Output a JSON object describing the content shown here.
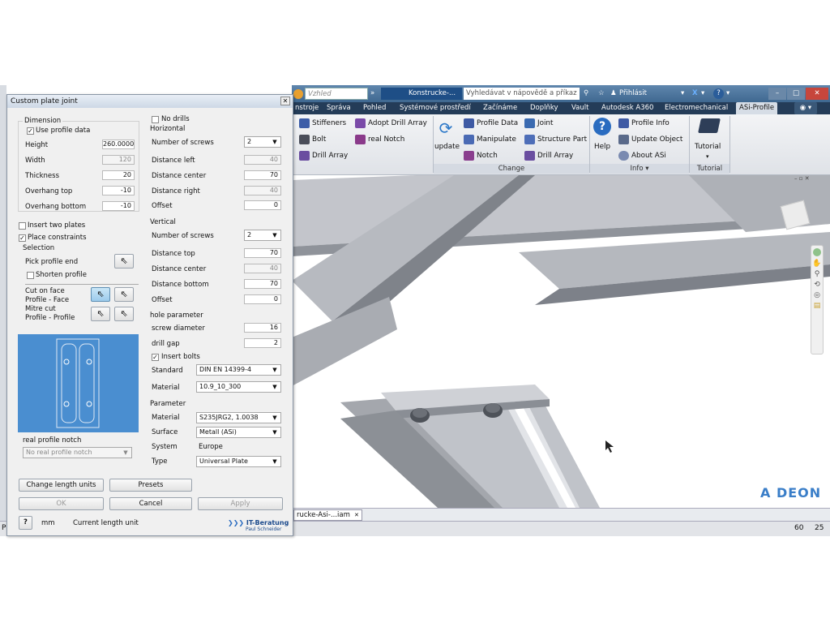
{
  "window": {
    "workspace": "Vzhled",
    "doc_title": "Konstrucke-...",
    "search_placeholder": "Vyhledávat v nápovědě a příkaz",
    "signin": "Přihlásit"
  },
  "ribbon_tabs": [
    "nstroje",
    "Správa",
    "Pohled",
    "Systémové prostředí",
    "Začínáme",
    "Doplňky",
    "Vault",
    "Autodesk A360",
    "Electromechanical",
    "ASi-Profile"
  ],
  "ribbon": {
    "col1": [
      "Stiffeners",
      "Bolt",
      "Drill Array"
    ],
    "col2": [
      "Adopt Drill Array",
      "real Notch"
    ],
    "update": "update",
    "col3": [
      "Profile Data",
      "Manipulate",
      "Notch"
    ],
    "col4": [
      "Joint",
      "Structure Part",
      "Drill Array"
    ],
    "help": "Help",
    "col5": [
      "Profile Info",
      "Update Object",
      "About ASi"
    ],
    "tutorial": "Tutorial",
    "groups": {
      "change": "Change",
      "info": "Info ▾",
      "tutorial": "Tutorial"
    }
  },
  "doc_tab": "rucke-Asi-...iam",
  "status": {
    "left": "P",
    "num1": "60",
    "num2": "25"
  },
  "watermark": "A DEON",
  "dialog": {
    "title": "Custom plate joint",
    "dimension": {
      "header": "Dimension",
      "use_profile_data": "Use profile data",
      "height_label": "Height",
      "height": "260.0000",
      "width_label": "Width",
      "width": "120",
      "thickness_label": "Thickness",
      "thickness": "20",
      "overhang_top_label": "Overhang top",
      "overhang_top": "-10",
      "overhang_bottom_label": "Overhang bottom",
      "overhang_bottom": "-10"
    },
    "insert_two_plates": "Insert two plates",
    "place_constraints": "Place constraints",
    "selection": {
      "header": "Selection",
      "pick_profile_end": "Pick profile end",
      "shorten_profile": "Shorten profile",
      "cut_on_face": "Cut on face",
      "profile_face": "Profile - Face",
      "mitre_cut": "Mitre cut",
      "profile_profile": "Profile - Profile"
    },
    "real_profile_notch": "real profile notch",
    "notch_select": "No real profile notch",
    "no_drills": "No drills",
    "horizontal": {
      "header": "Horizontal",
      "screws_label": "Number of screws",
      "screws": "2",
      "left_label": "Distance left",
      "left": "40",
      "center_label": "Distance center",
      "center": "70",
      "right_label": "Distance right",
      "right": "40",
      "offset_label": "Offset",
      "offset": "0"
    },
    "vertical": {
      "header": "Vertical",
      "screws_label": "Number of screws",
      "screws": "2",
      "top_label": "Distance top",
      "top": "70",
      "center_label": "Distance center",
      "center": "40",
      "bottom_label": "Distance bottom",
      "bottom": "70",
      "offset_label": "Offset",
      "offset": "0"
    },
    "hole": {
      "header": "hole parameter",
      "diameter_label": "screw diameter",
      "diameter": "16",
      "gap_label": "drill gap",
      "gap": "2",
      "insert_bolts": "Insert bolts",
      "standard_label": "Standard",
      "standard": "DIN EN 14399-4",
      "material_label": "Material",
      "material": "10.9_10_300"
    },
    "parameter": {
      "header": "Parameter",
      "material_label": "Material",
      "material": "S235JRG2, 1.0038",
      "surface_label": "Surface",
      "surface": "Metall (ASi)",
      "system_label": "System",
      "system": "Europe",
      "type_label": "Type",
      "type": "Universal Plate"
    },
    "buttons": {
      "change_units": "Change length units",
      "presets": "Presets",
      "ok": "OK",
      "cancel": "Cancel",
      "apply": "Apply"
    },
    "unit": "mm",
    "unit_label": "Current length unit",
    "logo": "IT-Beratung",
    "logo_sub": "Paul Schneider"
  }
}
